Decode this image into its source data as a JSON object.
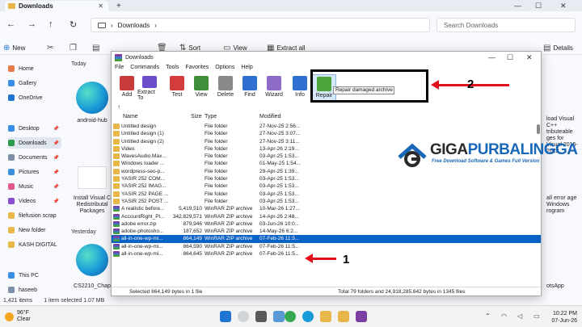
{
  "explorer": {
    "tab_title": "Downloads",
    "address_crumb": "Downloads",
    "search_placeholder": "Search Downloads",
    "commands": {
      "new": "New",
      "sort": "Sort",
      "view": "View",
      "extract_all": "Extract all",
      "details": "Details"
    },
    "sidebar": [
      {
        "label": "Home",
        "color": "#e8794a"
      },
      {
        "label": "Gallery",
        "color": "#3a8ee6"
      },
      {
        "label": "OneDrive",
        "color": "#1f76d2"
      },
      {
        "label": "Desktop",
        "color": "#3a8ee6",
        "pinned": true
      },
      {
        "label": "Downloads",
        "color": "#2b9a4d",
        "pinned": true
      },
      {
        "label": "Documents",
        "color": "#7b8fa6",
        "pinned": true
      },
      {
        "label": "Pictures",
        "color": "#3c8fd8",
        "pinned": true
      },
      {
        "label": "Music",
        "color": "#e05a8a",
        "pinned": true
      },
      {
        "label": "Videos",
        "color": "#8a4fd0",
        "pinned": true
      },
      {
        "label": "filefusion scrap",
        "color": "#e8b74a"
      },
      {
        "label": "New folder",
        "color": "#e8b74a"
      },
      {
        "label": "KASH DIGITAL",
        "color": "#e8b74a"
      },
      {
        "label": "This PC",
        "color": "#3a8ee6"
      },
      {
        "label": "haseeb",
        "color": "#7b8fa6"
      }
    ],
    "sections": {
      "today": "Today",
      "yesterday": "Yesterday"
    },
    "thumbs": {
      "android": "android-hub",
      "installvc": "Install Visual C Redistributal Packages",
      "cs2210": "CS2210_Chap"
    },
    "right_texts": {
      "a": "load Visual C++ tributeable ges for Visual 2015-2022",
      "b": "all error age Windows rogram",
      "c": "otsApp"
    },
    "status": {
      "items": "1,421 items",
      "selected": "1 item selected  1.07 MB"
    }
  },
  "winrar": {
    "title": "Downloads",
    "menu": [
      "File",
      "Commands",
      "Tools",
      "Favorites",
      "Options",
      "Help"
    ],
    "toolbar": [
      {
        "label": "Add",
        "color": "#c93a3a"
      },
      {
        "label": "Extract To",
        "color": "#6b4ec9"
      },
      {
        "label": "Test",
        "color": "#d33c3c"
      },
      {
        "label": "View",
        "color": "#3f8e3a"
      },
      {
        "label": "Delete",
        "color": "#8a8a8a"
      },
      {
        "label": "Find",
        "color": "#2f6fcf"
      },
      {
        "label": "Wizard",
        "color": "#8e6bc9"
      },
      {
        "label": "Info",
        "color": "#2f6fcf"
      },
      {
        "label": "Repair",
        "color": "#4ba33a"
      }
    ],
    "tooltip": "Repair damaged archive",
    "columns": {
      "name": "Name",
      "size": "Size",
      "type": "Type",
      "modified": "Modified"
    },
    "rows": [
      {
        "name": "Untitled design",
        "size": "",
        "type": "File folder",
        "modified": "27-Nov-25 2:56...",
        "kind": "folder"
      },
      {
        "name": "Untitled design (1)",
        "size": "",
        "type": "File folder",
        "modified": "27-Nov-25 3:07...",
        "kind": "folder"
      },
      {
        "name": "Untitled design (2)",
        "size": "",
        "type": "File folder",
        "modified": "27-Nov-25 3:11...",
        "kind": "folder"
      },
      {
        "name": "Video",
        "size": "",
        "type": "File folder",
        "modified": "13-Apr-26 2:19...",
        "kind": "folder"
      },
      {
        "name": "WavesAudio.Max...",
        "size": "",
        "type": "File folder",
        "modified": "03-Apr-25 1:53...",
        "kind": "folder"
      },
      {
        "name": "Windows loader ...",
        "size": "",
        "type": "File folder",
        "modified": "01-May-25 1:54...",
        "kind": "folder"
      },
      {
        "name": "wordpress-seo-p...",
        "size": "",
        "type": "File folder",
        "modified": "29-Apr-25 1:39...",
        "kind": "folder"
      },
      {
        "name": "YASIR 252 COM...",
        "size": "",
        "type": "File folder",
        "modified": "03-Apr-25 1:53...",
        "kind": "folder"
      },
      {
        "name": "YASIR 252 IMAG...",
        "size": "",
        "type": "File folder",
        "modified": "03-Apr-25 1:53...",
        "kind": "folder"
      },
      {
        "name": "YASIR 252 PAGE ...",
        "size": "",
        "type": "File folder",
        "modified": "03-Apr-25 1:53...",
        "kind": "folder"
      },
      {
        "name": "YASIR 252 POST ...",
        "size": "",
        "type": "File folder",
        "modified": "03-Apr-25 1:53...",
        "kind": "folder"
      },
      {
        "name": "A realistic before...",
        "size": "5,419,510",
        "type": "WinRAR ZIP archive",
        "modified": "10-Mar-26 1:27...",
        "kind": "zip"
      },
      {
        "name": "AccountRight_Pl...",
        "size": "342,829,571",
        "type": "WinRAR ZIP archive",
        "modified": "14-Apr-26 2:48...",
        "kind": "zip"
      },
      {
        "name": "adobe error.zip",
        "size": "879,946",
        "type": "WinRAR ZIP archive",
        "modified": "03-Jun-26 10:0...",
        "kind": "zip"
      },
      {
        "name": "adobe-photosho...",
        "size": "187,652",
        "type": "WinRAR ZIP archive",
        "modified": "14-May-26 6:2...",
        "kind": "zip"
      },
      {
        "name": "all-in-one-wp-mi...",
        "size": "864,149",
        "type": "WinRAR ZIP archive",
        "modified": "07-Feb-26 11:5...",
        "kind": "zip",
        "selected": true
      },
      {
        "name": "all-in-one-wp-mi...",
        "size": "864,590",
        "type": "WinRAR ZIP archive",
        "modified": "07-Feb-26 11:5...",
        "kind": "zip"
      },
      {
        "name": "all-in-one-wp-mi...",
        "size": "864,645",
        "type": "WinRAR ZIP archive",
        "modified": "07-Feb-26 11:5...",
        "kind": "zip"
      }
    ],
    "status_left": "Selected 864,149 bytes in 1 file",
    "status_right": "Total 79 folders and 24,918,285,642 bytes in 1345 files"
  },
  "annotations": {
    "one": "1",
    "two": "2",
    "color": "#e0111d"
  },
  "watermark": {
    "title_a": "GIGA",
    "title_b": "PURBALINGGA",
    "subtitle": "Free Download Software & Games Full Version"
  },
  "taskbar": {
    "weather_temp": "96°F",
    "weather_desc": "Clear",
    "time": "10:22 PM",
    "date": "07-Jun-26"
  }
}
